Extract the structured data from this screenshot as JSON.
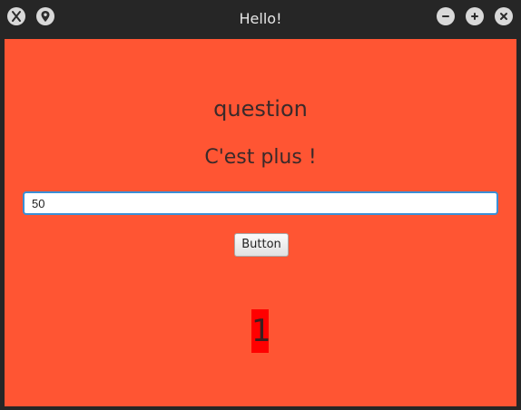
{
  "window": {
    "title": "Hello!",
    "left_icons": [
      "x-icon",
      "location-pin-icon"
    ],
    "right_icons": [
      "minimize-icon",
      "maximize-icon",
      "close-icon"
    ]
  },
  "main": {
    "question_label": "question",
    "hint_label": "C'est plus !",
    "answer_input_value": "50",
    "button_label": "Button",
    "counter_value": "1"
  },
  "colors": {
    "content_background": "#ff5533",
    "counter_background": "#ff0000",
    "input_focus_border": "#3a8fd6"
  }
}
